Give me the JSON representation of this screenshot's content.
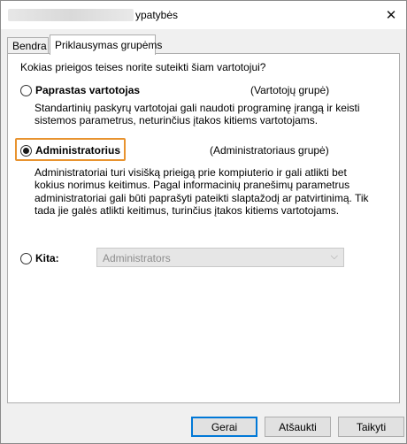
{
  "window": {
    "title": "ypatybės"
  },
  "tabs": [
    {
      "label": "Bendra"
    },
    {
      "label": "Priklausymas grupėms"
    }
  ],
  "panel": {
    "question": "Kokias prieigos teises norite suteikti šiam vartotojui?",
    "options": [
      {
        "label": "Paprastas vartotojas",
        "group": "(Vartotojų grupė)",
        "description": "Standartinių paskyrų vartotojai gali naudoti programinę įrangą ir keisti sistemos parametrus, neturinčius įtakos kitiems vartotojams.",
        "checked": false
      },
      {
        "label": "Administratorius",
        "group": "(Administratoriaus grupė)",
        "description": "Administratoriai turi visišką prieigą prie kompiuterio ir gali atlikti bet kokius norimus keitimus. Pagal informacinių pranešimų parametrus administratoriai gali būti paprašyti pateikti slaptažodį ar patvirtinimą. Tik tada jie galės atlikti keitimus, turinčius įtakos kitiems vartotojams.",
        "checked": true
      },
      {
        "label": "Kita:",
        "select_value": "Administrators",
        "checked": false
      }
    ]
  },
  "buttons": {
    "ok": "Gerai",
    "cancel": "Atšaukti",
    "apply": "Taikyti"
  },
  "colors": {
    "focus_highlight": "#e8932f",
    "default_button_border": "#0078d7"
  },
  "icons": {
    "close": "close-icon",
    "dropdown": "chevron-down-icon"
  }
}
